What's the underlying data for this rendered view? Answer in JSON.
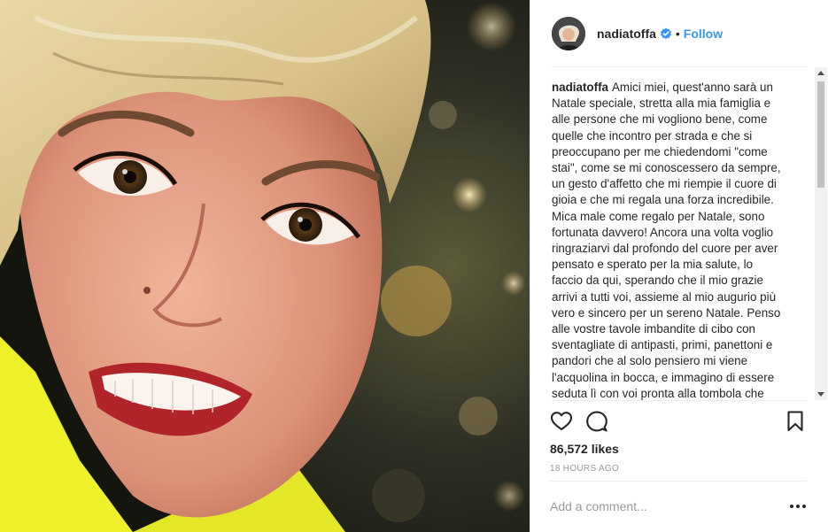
{
  "photo": {
    "alt": "Close-up portrait of a smiling woman with short blonde hair, Christmas lights behind"
  },
  "header": {
    "username": "nadiatoffa",
    "verified_icon": "verified-badge-icon",
    "separator": "•",
    "follow_label": "Follow"
  },
  "caption": {
    "author": "nadiatoffa",
    "text": "Amici miei, quest'anno sarà un Natale speciale, stretta alla mia famiglia e alle persone che mi vogliono bene, come quelle che incontro per strada e che si preoccupano per me chiedendomi \"come stai\", come se mi conoscessero da sempre, un gesto d'affetto che mi riempie il cuore di gioia e che mi regala una forza incredibile. Mica male come regalo per Natale, sono fortunata davvero! Ancora una volta voglio ringraziarvi dal profondo del cuore per aver pensato e sperato per la mia salute, lo faccio da qui, sperando che il mio grazie arrivi a tutti voi, assieme al mio augurio più vero e sincero per un sereno Natale. Penso alle vostre tavole imbandite di cibo con sventagliate di antipasti, primi, panettoni e pandori che al solo pensiero mi viene l'acquolina in bocca, e immagino di essere seduta lì con voi pronta alla tombola che sarà tutti 🎅❤️"
  },
  "actions": {
    "like_icon": "heart-icon",
    "comment_icon": "comment-icon",
    "save_icon": "bookmark-icon"
  },
  "likes": "86,572 likes",
  "timestamp": "18 HOURS AGO",
  "comment": {
    "placeholder": "Add a comment..."
  },
  "more_icon": "more-options-icon",
  "colors": {
    "link_blue": "#3897f0",
    "text": "#262626",
    "muted": "#999999",
    "divider": "#efefef"
  }
}
